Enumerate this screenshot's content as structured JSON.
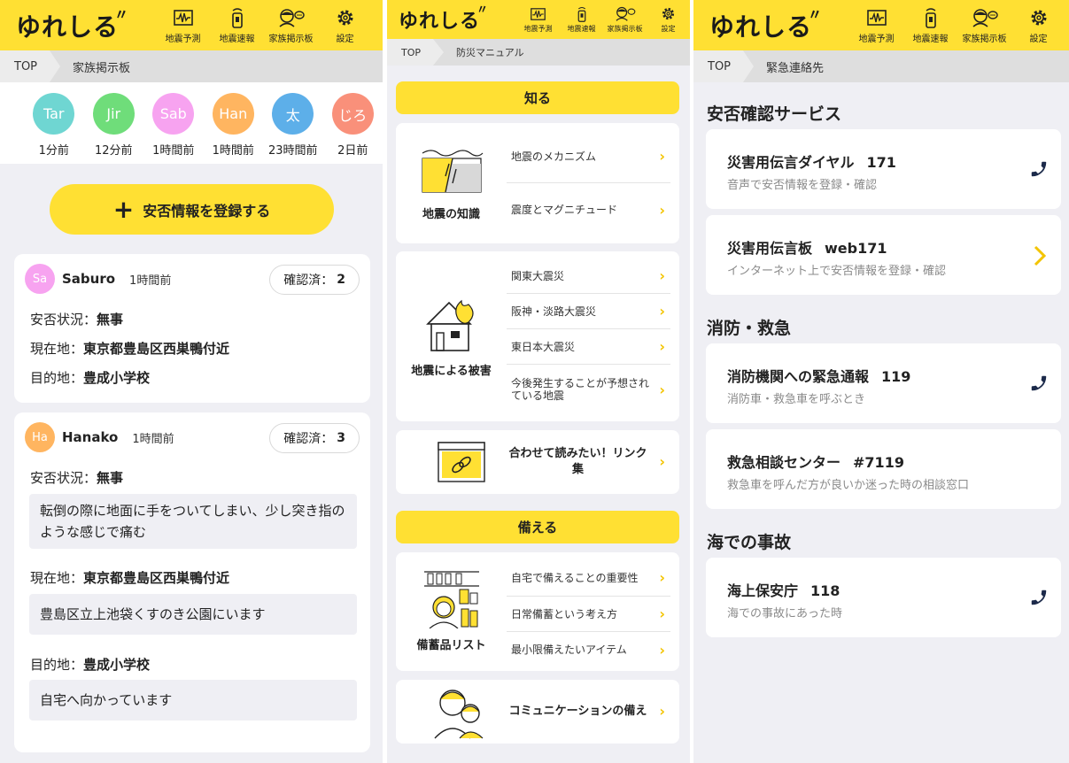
{
  "header": {
    "logo": "ゆれしる",
    "nav": [
      "地震予測",
      "地震速報",
      "家族掲示板",
      "設定"
    ]
  },
  "screen1": {
    "breadcrumb": {
      "home": "TOP",
      "current": "家族掲示板"
    },
    "avatars": [
      {
        "initial": "Tar",
        "ago": "1分前",
        "color": "#6fd6d2"
      },
      {
        "initial": "Jir",
        "ago": "12分前",
        "color": "#6fdd7a"
      },
      {
        "initial": "Sab",
        "ago": "1時間前",
        "color": "#f7a3f0"
      },
      {
        "initial": "Han",
        "ago": "1時間前",
        "color": "#ffb560"
      },
      {
        "initial": "太",
        "ago": "23時間前",
        "color": "#5dafe9"
      },
      {
        "initial": "じろ",
        "ago": "2日前",
        "color": "#f9907a"
      }
    ],
    "register_label": "安否情報を登録する",
    "posts": [
      {
        "initial": "Sa",
        "name": "Saburo",
        "ago": "1時間前",
        "color": "#f7a3f0",
        "confirm_label": "確認済：",
        "confirm_count": "2",
        "status_label": "安否状況：",
        "status_value": "無事",
        "location_label": "現在地：",
        "location_value": "東京都豊島区西巣鴨付近",
        "dest_label": "目的地：",
        "dest_value": "豊成小学校"
      },
      {
        "initial": "Ha",
        "name": "Hanako",
        "ago": "1時間前",
        "color": "#ffb560",
        "confirm_label": "確認済：",
        "confirm_count": "3",
        "status_label": "安否状況：",
        "status_value": "無事",
        "status_note": "転倒の際に地面に手をついてしまい、少し突き指のような感じで痛む",
        "location_label": "現在地：",
        "location_value": "東京都豊島区西巣鴨付近",
        "location_note": "豊島区立上池袋くすのき公園にいます",
        "dest_label": "目的地：",
        "dest_value": "豊成小学校",
        "dest_note": "自宅へ向かっています"
      }
    ]
  },
  "screen2": {
    "breadcrumb": {
      "home": "TOP",
      "current": "防災マニュアル"
    },
    "section_know": "知る",
    "quake_knowledge": {
      "label": "地震の知識",
      "links": [
        "地震のメカニズム",
        "震度とマグニチュード"
      ]
    },
    "quake_damage": {
      "label": "地震による被害",
      "links": [
        "関東大震災",
        "阪神・淡路大震災",
        "東日本大震災",
        "今後発生することが予想されている地震"
      ]
    },
    "link_collection": "合わせて読みたい！リンク集",
    "section_prepare": "備える",
    "stock_list": {
      "label": "備蓄品リスト",
      "links": [
        "自宅で備えることの重要性",
        "日常備蓄という考え方",
        "最小限備えたいアイテム"
      ]
    },
    "communication": "コミュニケーションの備え"
  },
  "screen3": {
    "breadcrumb": {
      "home": "TOP",
      "current": "緊急連絡先"
    },
    "sec_safety": "安否確認サービス",
    "dial171": {
      "title": "災害用伝言ダイヤル",
      "num": "171",
      "sub": "音声で安否情報を登録・確認"
    },
    "web171": {
      "title": "災害用伝言板",
      "num": "web171",
      "sub": "インターネット上で安否情報を登録・確認"
    },
    "sec_fire": "消防・救急",
    "fire119": {
      "title": "消防機関への緊急通報",
      "num": "119",
      "sub": "消防車・救急車を呼ぶとき"
    },
    "consult7119": {
      "title": "救急相談センター",
      "num": "#7119",
      "sub": "救急車を呼んだ方が良いか迷った時の相談窓口"
    },
    "sec_sea": "海での事故",
    "coast118": {
      "title": "海上保安庁",
      "num": "118",
      "sub": "海での事故にあった時"
    }
  },
  "colors": {
    "brand_yellow": "#ffe033",
    "navy": "#1c2a4a"
  }
}
